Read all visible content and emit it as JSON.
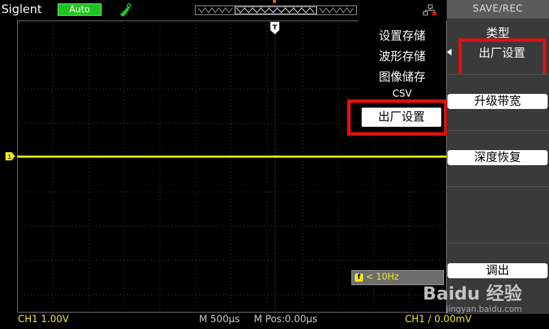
{
  "header": {
    "brand": "Siglent",
    "mode": "Auto",
    "colors": {
      "mode_bg": "#1fc31f",
      "trace": "#f2ea1a",
      "highlight": "#e01010"
    }
  },
  "overlay_menu": {
    "items": [
      "设置存储",
      "波形存储",
      "图像储存",
      "CSV"
    ],
    "selected": "出厂设置"
  },
  "side_menu": {
    "title": "SAVE/REC",
    "type_label": "类型",
    "type_value": "出厂设置",
    "upgrade_bandwidth": "升级带宽",
    "deep_recovery": "深度恢复",
    "recall": "调出"
  },
  "measure": {
    "freq_icon": "f",
    "freq_text": "< 10Hz"
  },
  "status": {
    "ch1": "CH1 1.00V",
    "timebase": "M 500μs",
    "mpos": "M Pos:0.00μs",
    "trigger": "CH1 ∕ 0.00mV"
  },
  "watermark": {
    "logo": "Baidu 经验",
    "url": "jingyan.baidu.com"
  }
}
